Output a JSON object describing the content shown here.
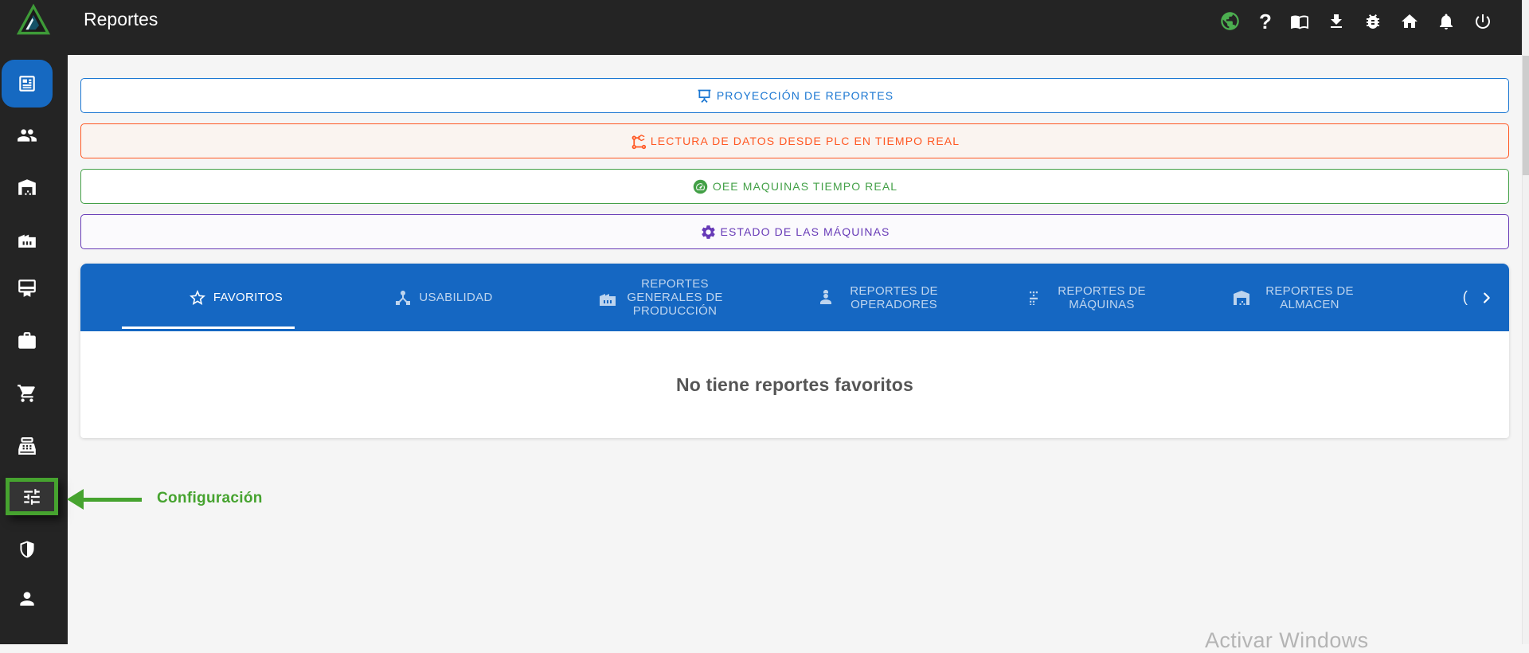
{
  "colors": {
    "topbar_bg": "#242424",
    "sidebar_bg": "#242424",
    "active_item_blue": "#1669c1",
    "tabbar_blue": "#1567c2",
    "page_bg": "#f5f5f5",
    "annotation_green": "#46a32f"
  },
  "topbar": {
    "title": "Reportes",
    "logo_icon": "triangle-logo",
    "action_icons": [
      "globe-icon",
      "help-icon",
      "manual-book-icon",
      "download-icon",
      "bug-report-icon",
      "home-icon",
      "notifications-bell-icon",
      "power-icon"
    ],
    "help_glyph": "?"
  },
  "sidebar": {
    "active_index": 0,
    "highlighted_index": 8,
    "icons": [
      "reports-newspaper-icon",
      "users-group-icon",
      "warehouse-icon",
      "factory-icon",
      "certificate-icon",
      "briefcase-icon",
      "shopping-cart-icon",
      "cash-register-icon",
      "settings-sliders-icon",
      "shield-icon",
      "person-icon"
    ]
  },
  "quick_access_buttons": [
    {
      "label": "PROYECCIÓN DE REPORTES",
      "icon": "projection-screen-icon",
      "accent": "#1976d2"
    },
    {
      "label": "LECTURA DE DATOS DESDE PLC EN TIEMPO REAL",
      "icon": "robot-arm-icon",
      "accent": "#ff5722"
    },
    {
      "label": "OEE MAQUINAS TIEMPO REAL",
      "icon": "gauge-icon",
      "accent": "#43a047"
    },
    {
      "label": "ESTADO DE LAS MÁQUINAS",
      "icon": "gear-icon",
      "accent": "#673ab7"
    }
  ],
  "report_tabs": {
    "items": [
      {
        "label": "FAVORITOS",
        "icon": "star-icon",
        "active": true
      },
      {
        "label": "USABILIDAD",
        "icon": "hub-icon",
        "active": false
      },
      {
        "label": "REPORTES GENERALES DE PRODUCCIÓN",
        "icon": "factory-icon",
        "active": false
      },
      {
        "label": "REPORTES DE OPERADORES",
        "icon": "operator-icon",
        "active": false
      },
      {
        "label": "REPORTES DE MÁQUINAS",
        "icon": "machine-icon",
        "active": false
      },
      {
        "label": "REPORTES DE ALMACEN",
        "icon": "warehouse-icon",
        "active": false
      }
    ],
    "overflow_partial_label": "(",
    "scroll_icon": "chevron-right-icon"
  },
  "favorites_panel": {
    "empty_message": "No tiene reportes favoritos"
  },
  "annotation": {
    "label": "Configuración",
    "accent": "#46a32f"
  },
  "os_watermark": {
    "line1": "Activar Windows"
  }
}
